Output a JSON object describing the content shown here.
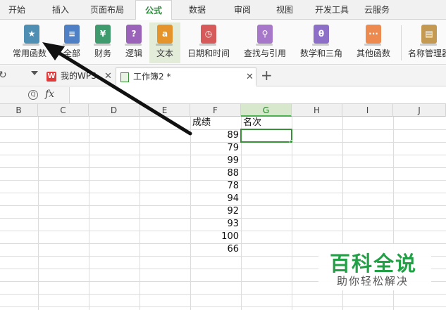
{
  "menu": {
    "tabs": [
      "开始",
      "插入",
      "页面布局",
      "公式",
      "数据",
      "审阅",
      "视图",
      "开发工具",
      "云服务"
    ],
    "active": "公式"
  },
  "ribbon": {
    "buttons": [
      {
        "label": "常用函数",
        "icon": "star-icon",
        "glyph": "★",
        "color": "#4e8fb3"
      },
      {
        "label": "全部",
        "icon": "list-icon",
        "glyph": "≡",
        "color": "#4f7fc4"
      },
      {
        "label": "财务",
        "icon": "finance-icon",
        "glyph": "¥",
        "color": "#3f9a6d"
      },
      {
        "label": "逻辑",
        "icon": "question-icon",
        "glyph": "?",
        "color": "#9a62b8"
      },
      {
        "label": "文本",
        "icon": "text-a-icon",
        "glyph": "a",
        "color": "#e4942a"
      },
      {
        "label": "日期和时间",
        "icon": "clock-icon",
        "glyph": "◷",
        "color": "#d65a5a"
      },
      {
        "label": "查找与引用",
        "icon": "search-icon",
        "glyph": "⚲",
        "color": "#a777c9"
      },
      {
        "label": "数学和三角",
        "icon": "theta-icon",
        "glyph": "θ",
        "color": "#8d6fc8"
      },
      {
        "label": "其他函数",
        "icon": "more-icon",
        "glyph": "···",
        "color": "#ec8a4f"
      },
      {
        "label": "名称管理器",
        "icon": "name-manager-icon",
        "glyph": "▤",
        "color": "#c49a52"
      }
    ]
  },
  "doc_tabs": {
    "tabs": [
      {
        "label": "我的WPS",
        "icon": "wps-logo-icon"
      },
      {
        "label": "工作簿2 *",
        "icon": "spreadsheet-icon"
      }
    ],
    "new_tab": "+"
  },
  "formula_bar": {
    "fx": "fx",
    "value": ""
  },
  "columns": [
    "B",
    "C",
    "D",
    "E",
    "F",
    "G",
    "H",
    "I",
    "J"
  ],
  "selected_column": "G",
  "cells": {
    "header_f": "成绩",
    "header_g": "名次",
    "scores": [
      "89",
      "79",
      "99",
      "88",
      "78",
      "94",
      "92",
      "93",
      "100",
      "66"
    ]
  },
  "watermark": {
    "title": "百科全说",
    "subtitle": "助你轻松解决"
  }
}
